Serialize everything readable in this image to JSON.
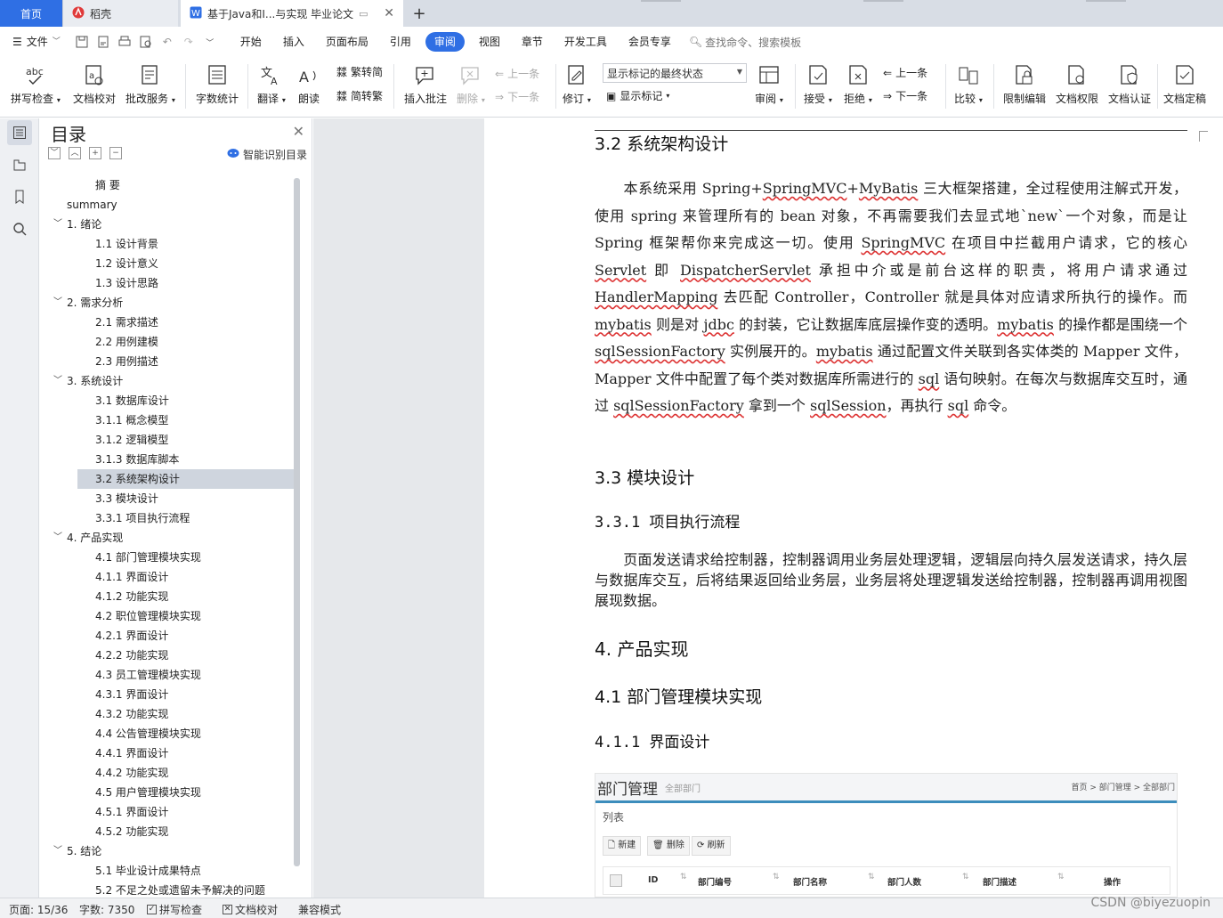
{
  "tabs": {
    "home": "首页",
    "docer": "稻壳",
    "doc": "基于Java和I...与实现 毕业论文"
  },
  "menu": {
    "file": "文件",
    "items": [
      "开始",
      "插入",
      "页面布局",
      "引用",
      "审阅",
      "视图",
      "章节",
      "开发工具",
      "会员专享"
    ],
    "active": "审阅",
    "search_placeholder": "查找命令、搜索模板"
  },
  "ribbon": {
    "spell": "拼写检查",
    "proof": "文档校对",
    "batch": "批改服务",
    "wordcount": "字数统计",
    "translate": "翻译",
    "read": "朗读",
    "trad": "繁转简",
    "simp": "简转繁",
    "insert_comment": "插入批注",
    "delete": "删除",
    "prev_comment": "上一条",
    "next_comment": "下一条",
    "revise": "修订",
    "markup_state": "显示标记的最终状态",
    "show_markup": "显示标记",
    "review": "审阅",
    "accept": "接受",
    "reject": "拒绝",
    "prev": "上一条",
    "next": "下一条",
    "compare": "比较",
    "restrict": "限制编辑",
    "permission": "文档权限",
    "cert": "文档认证",
    "finalize": "文档定稿"
  },
  "toc": {
    "title": "目录",
    "smart": "智能识别目录",
    "items": [
      {
        "label": "摘  要",
        "level": 0
      },
      {
        "label": "summary",
        "level": 0
      },
      {
        "label": "1.   绪论",
        "level": 1
      },
      {
        "label": "1.1 设计背景",
        "level": 2
      },
      {
        "label": "1.2 设计意义",
        "level": 2
      },
      {
        "label": "1.3 设计思路",
        "level": 2
      },
      {
        "label": "2. 需求分析",
        "level": 1
      },
      {
        "label": "2.1 需求描述",
        "level": 2
      },
      {
        "label": "2.2 用例建模",
        "level": 2
      },
      {
        "label": "2.3 用例描述",
        "level": 2
      },
      {
        "label": "3. 系统设计",
        "level": 1
      },
      {
        "label": "3.1 数据库设计",
        "level": 2
      },
      {
        "label": "3.1.1 概念模型",
        "level": 2
      },
      {
        "label": "3.1.2 逻辑模型",
        "level": 2
      },
      {
        "label": "3.1.3 数据库脚本",
        "level": 2
      },
      {
        "label": "3.2 系统架构设计",
        "level": 2,
        "selected": true
      },
      {
        "label": "3.3 模块设计",
        "level": 2
      },
      {
        "label": "3.3.1 项目执行流程",
        "level": 2
      },
      {
        "label": "4. 产品实现",
        "level": 1
      },
      {
        "label": "4.1 部门管理模块实现",
        "level": 2
      },
      {
        "label": "4.1.1 界面设计",
        "level": 2
      },
      {
        "label": "4.1.2 功能实现",
        "level": 2
      },
      {
        "label": "4.2 职位管理模块实现",
        "level": 2
      },
      {
        "label": "4.2.1 界面设计",
        "level": 2
      },
      {
        "label": "4.2.2 功能实现",
        "level": 2
      },
      {
        "label": "4.3 员工管理模块实现",
        "level": 2
      },
      {
        "label": "4.3.1 界面设计",
        "level": 2
      },
      {
        "label": "4.3.2 功能实现",
        "level": 2
      },
      {
        "label": "4.4 公告管理模块实现",
        "level": 2
      },
      {
        "label": "4.4.1 界面设计",
        "level": 2
      },
      {
        "label": "4.4.2 功能实现",
        "level": 2
      },
      {
        "label": "4.5 用户管理模块实现",
        "level": 2
      },
      {
        "label": "4.5.1 界面设计",
        "level": 2
      },
      {
        "label": "4.5.2 功能实现",
        "level": 2
      },
      {
        "label": "5. 结论",
        "level": 1
      },
      {
        "label": "5.1 毕业设计成果特点",
        "level": 2
      },
      {
        "label": "5.2 不足之处或遗留未予解决的问题",
        "level": 2
      }
    ]
  },
  "doc": {
    "h_32": "3.2  系统架构设计",
    "h_33": "3.3  模块设计",
    "h_331": "3.3.1  项目执行流程",
    "h_4": "4.   产品实现",
    "h_41": "4.1  部门管理模块实现",
    "h_411": "4.1.1  界面设计",
    "p2": "页面发送请求给控制器，控制器调用业务层处理逻辑，逻辑层向持久层发送请求，持久层与数据库交互，后将结果返回给业务层，业务层将处理逻辑发送给控制器，控制器再调用视图展现数据。"
  },
  "shot": {
    "title": "部门管理",
    "subtitle": "全部部门",
    "breadcrumb": "首页  >  部门管理  >  全部部门",
    "list": "列表",
    "btn_new": "新建",
    "btn_delete": "删除",
    "btn_refresh": "刷新",
    "cols": [
      "ID",
      "部门编号",
      "部门名称",
      "部门人数",
      "部门描述",
      "操作"
    ]
  },
  "status": {
    "page": "页面: 15/36",
    "words": "字数: 7350",
    "spell": "拼写检查",
    "proof": "文档校对",
    "compat": "兼容模式",
    "watermark": "CSDN @biyezuopin"
  }
}
